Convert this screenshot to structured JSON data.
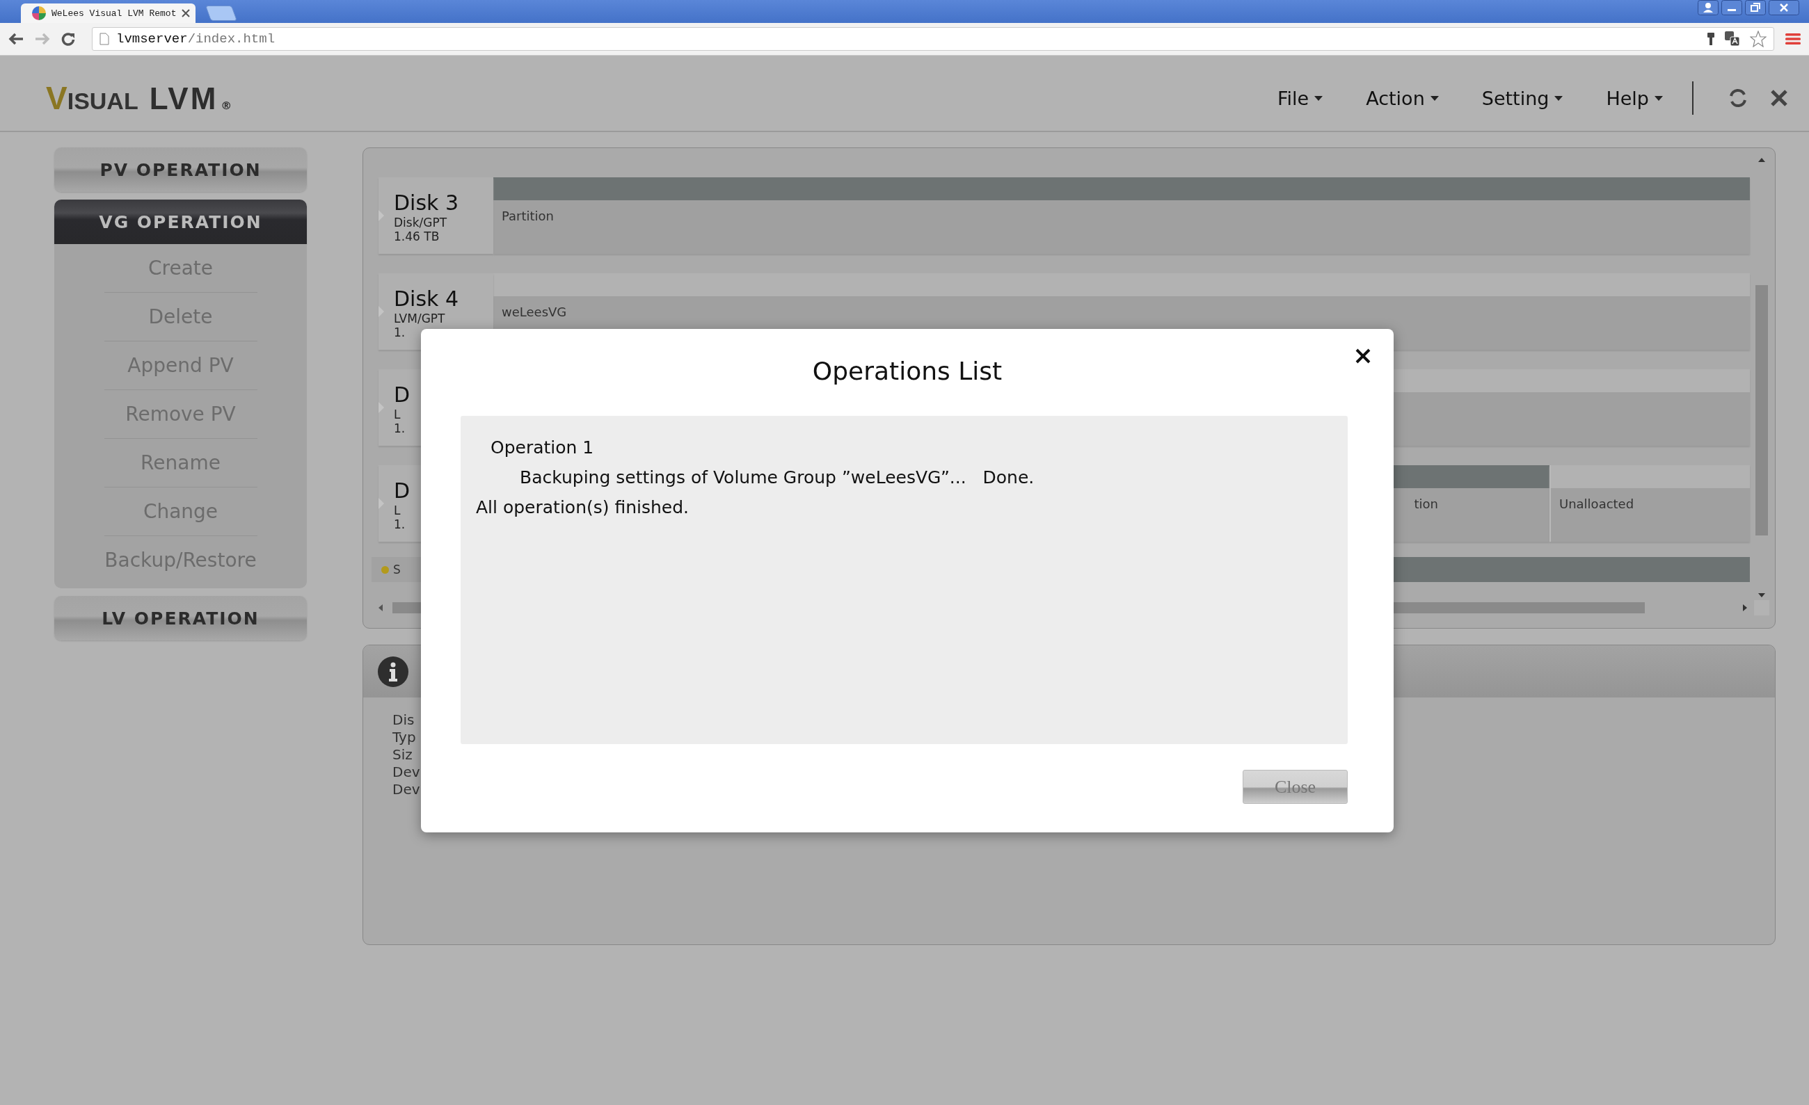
{
  "browser": {
    "tab_title": "WeLees Visual LVM Remot",
    "url_host": "lvmserver",
    "url_path": "/index.html"
  },
  "logo": {
    "initial": "V",
    "rest": "ISUAL",
    "product": "LVM",
    "mark": "®"
  },
  "menu": [
    {
      "label": "File"
    },
    {
      "label": "Action"
    },
    {
      "label": "Setting"
    },
    {
      "label": "Help"
    }
  ],
  "sidebar": [
    {
      "label": "PV OPERATION",
      "expanded": false
    },
    {
      "label": "VG OPERATION",
      "expanded": true,
      "items": [
        "Create",
        "Delete",
        "Append PV",
        "Remove PV",
        "Rename",
        "Change",
        "Backup/Restore"
      ]
    },
    {
      "label": "LV OPERATION",
      "expanded": false
    }
  ],
  "disks": [
    {
      "name": "Disk 3",
      "type": "Disk/GPT",
      "size": "1.46 TB",
      "parts": [
        {
          "kind": "partition",
          "label": "Partition"
        }
      ]
    },
    {
      "name": "Disk 4",
      "type": "LVM/GPT",
      "size": "1.",
      "parts": [
        {
          "kind": "volume_group",
          "label": "weLeesVG"
        }
      ]
    },
    {
      "name": "D",
      "type": "L",
      "size": "1.",
      "parts": [
        {
          "kind": "volume_group"
        }
      ]
    },
    {
      "name": "D",
      "type": "L",
      "size": "1.",
      "parts": [
        {
          "kind": "partition",
          "label": "tion"
        },
        {
          "kind": "free",
          "label": "Unalloacted"
        }
      ]
    }
  ],
  "legend": {
    "label": "S",
    "color": "#b39a1c"
  },
  "info": {
    "lines": [
      "Dis",
      "Typ",
      "Siz",
      "Dev",
      "Dev"
    ]
  },
  "dialog": {
    "title": "Operations List",
    "lines": [
      {
        "kind": "heading",
        "text": "Operation 1"
      },
      {
        "kind": "step",
        "text": "Backuping settings of Volume Group ”weLeesVG”...   Done."
      },
      {
        "kind": "summary",
        "text": "All operation(s) finished."
      }
    ],
    "button": "Close"
  }
}
